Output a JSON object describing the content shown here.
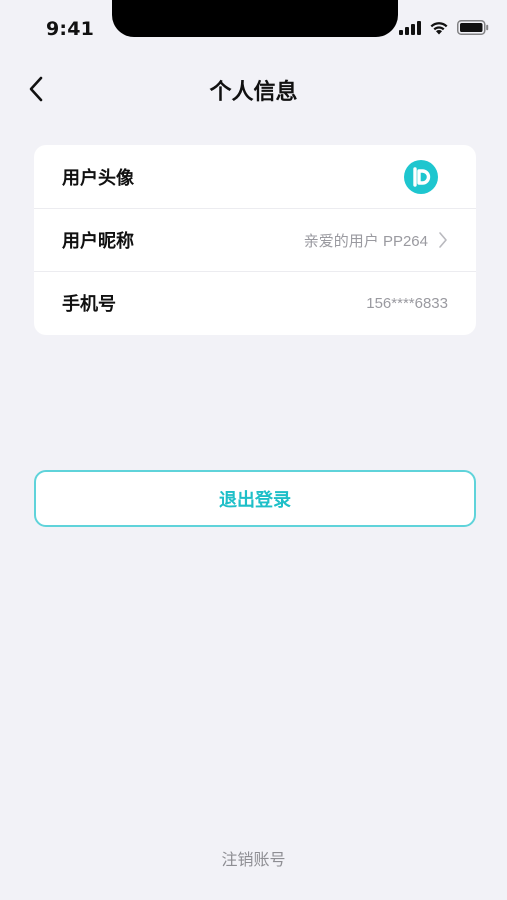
{
  "status_bar": {
    "time": "9:41",
    "icons": [
      "signal-icon",
      "wifi-icon",
      "battery-icon"
    ]
  },
  "nav": {
    "title": "个人信息",
    "back_icon": "chevron-left-icon"
  },
  "profile": {
    "rows": [
      {
        "label": "用户头像",
        "value": "",
        "type": "avatar"
      },
      {
        "label": "用户昵称",
        "value": "亲爱的用户 PP264",
        "type": "link"
      },
      {
        "label": "手机号",
        "value": "156****6833",
        "type": "text"
      }
    ]
  },
  "actions": {
    "logout_label": "退出登录",
    "deactivate_label": "注销账号"
  },
  "colors": {
    "accent": "#1ebfc8",
    "accent_border": "#5fd3da",
    "background": "#f2f2f7",
    "card": "#ffffff",
    "muted_text": "#9a9aa0"
  }
}
